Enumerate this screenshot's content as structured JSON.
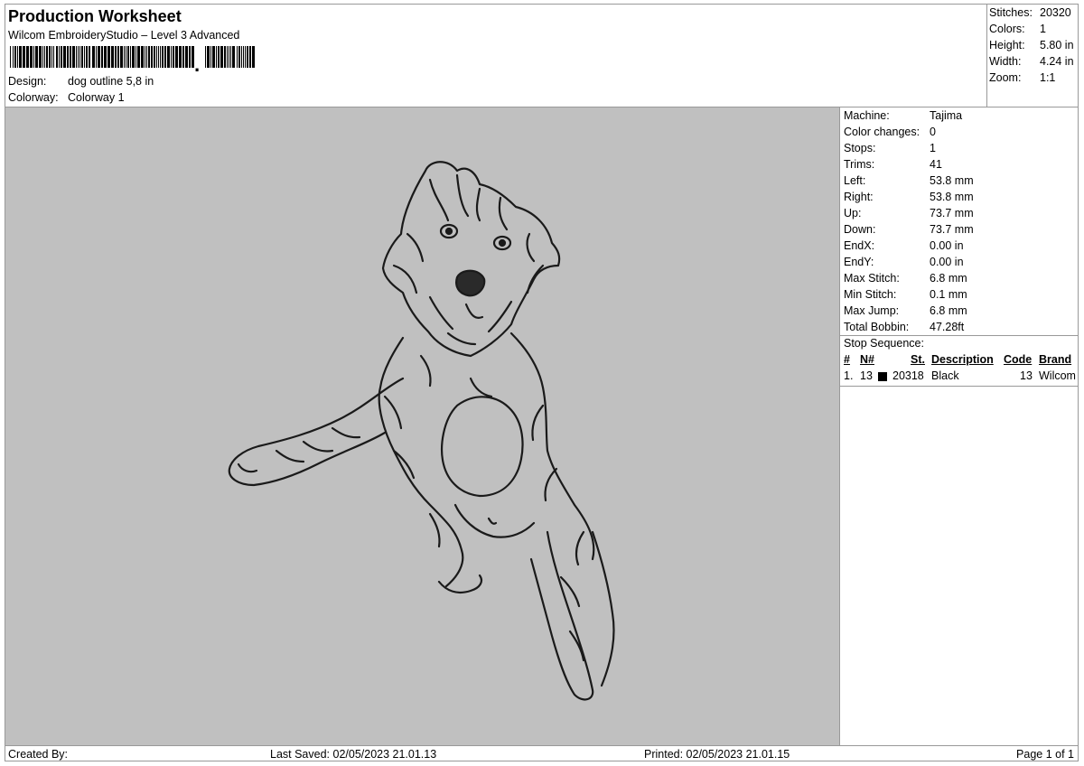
{
  "header": {
    "title": "Production Worksheet",
    "software": "Wilcom EmbroideryStudio – Level 3 Advanced",
    "design_label": "Design:",
    "design_value": "dog outline 5,8 in",
    "colorway_label": "Colorway:",
    "colorway_value": "Colorway 1"
  },
  "stats": [
    {
      "label": "Stitches:",
      "value": "20320"
    },
    {
      "label": "Colors:",
      "value": "1"
    },
    {
      "label": "Height:",
      "value": "5.80 in"
    },
    {
      "label": "Width:",
      "value": "4.24 in"
    },
    {
      "label": "Zoom:",
      "value": "1:1"
    }
  ],
  "info": [
    {
      "label": "Machine:",
      "value": "Tajima"
    },
    {
      "label": "Color changes:",
      "value": "0"
    },
    {
      "label": "Stops:",
      "value": "1"
    },
    {
      "label": "Trims:",
      "value": "41"
    },
    {
      "label": "Left:",
      "value": "53.8 mm"
    },
    {
      "label": "Right:",
      "value": "53.8 mm"
    },
    {
      "label": "Up:",
      "value": "73.7 mm"
    },
    {
      "label": "Down:",
      "value": "73.7 mm"
    },
    {
      "label": "EndX:",
      "value": "0.00 in"
    },
    {
      "label": "EndY:",
      "value": "0.00 in"
    },
    {
      "label": "Max Stitch:",
      "value": "6.8 mm"
    },
    {
      "label": "Min Stitch:",
      "value": "0.1 mm"
    },
    {
      "label": "Max Jump:",
      "value": "6.8 mm"
    },
    {
      "label": "Total Bobbin:",
      "value": "47.28ft"
    }
  ],
  "stop_sequence": {
    "title": "Stop Sequence:",
    "headers": {
      "num": "#",
      "n": "N#",
      "st": "St.",
      "description": "Description",
      "code": "Code",
      "brand": "Brand"
    },
    "rows": [
      {
        "num": "1.",
        "n": "13",
        "st": "20318",
        "description": "Black",
        "code": "13",
        "brand": "Wilcom",
        "color": "#000000"
      }
    ]
  },
  "footer": {
    "created_by": "Created By:",
    "last_saved": "Last Saved: 02/05/2023 21.01.13",
    "printed": "Printed: 02/05/2023 21.01.15",
    "page": "Page 1 of 1"
  },
  "colors": {
    "canvas_bg": "#c0c0c0",
    "thread": "#1a1a1a"
  }
}
